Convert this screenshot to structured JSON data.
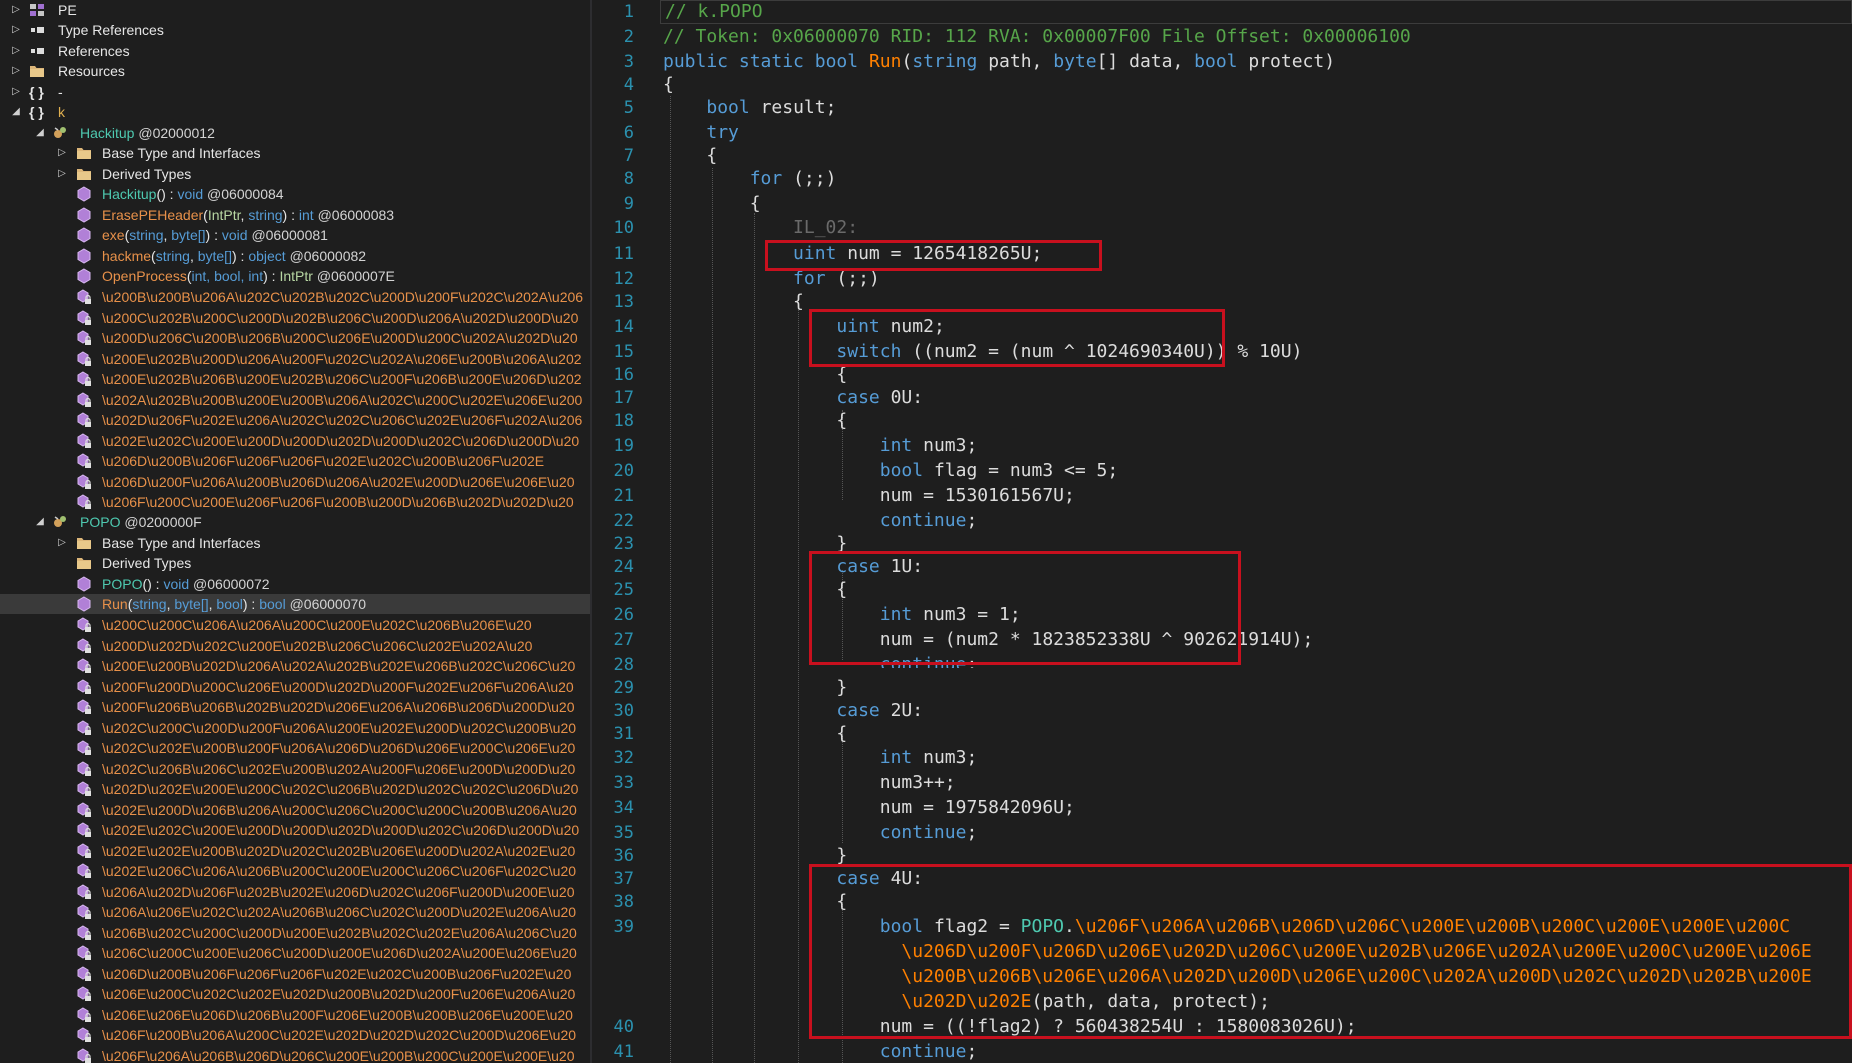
{
  "tree": {
    "top_items": [
      {
        "label": "PE",
        "icon": "pe-module-icon"
      },
      {
        "label": "Type References",
        "icon": "type-references-icon"
      },
      {
        "label": "References",
        "icon": "references-icon"
      },
      {
        "label": "Resources",
        "icon": "folder-icon"
      },
      {
        "label": "-",
        "icon": "namespace-braces-icon"
      },
      {
        "label": "k",
        "icon": "namespace-braces-icon"
      }
    ],
    "hackitup": {
      "name": "Hackitup",
      "token": "@02000012",
      "base_types": "Base Type and Interfaces",
      "derived_types": "Derived Types",
      "methods": [
        {
          "name": "Hackitup",
          "sig": "() : ",
          "ret": "void",
          "tok": "@06000084"
        },
        {
          "name": "ErasePEHeader",
          "p1": "IntPtr",
          "p2": "string",
          "ret": "int",
          "tok": "@06000083"
        },
        {
          "name": "exe",
          "p1": "string",
          "p2": "byte[]",
          "ret": "void",
          "tok": "@06000081"
        },
        {
          "name": "hackme",
          "p1": "string",
          "p2": "byte[]",
          "ret": "object",
          "tok": "@06000082"
        },
        {
          "name": "OpenProcess",
          "p1": "int, bool, int",
          "ret": "IntPtr",
          "tok": "@0600007E"
        }
      ],
      "obf_members": [
        "\\u200B\\u200B\\u206A\\u202C\\u202B\\u202C\\u200D\\u200F\\u202C\\u202A\\u206",
        "\\u200C\\u202B\\u200C\\u200D\\u202B\\u206C\\u200D\\u206A\\u202D\\u200D\\u20",
        "\\u200D\\u206C\\u200B\\u206B\\u200C\\u206E\\u200D\\u200C\\u202A\\u202D\\u20",
        "\\u200E\\u202B\\u200D\\u206A\\u200F\\u202C\\u202A\\u206E\\u200B\\u206A\\u202",
        "\\u200E\\u202B\\u206B\\u200E\\u202B\\u206C\\u200F\\u206B\\u200E\\u206D\\u202",
        "\\u202A\\u202B\\u200B\\u200E\\u200B\\u206A\\u202C\\u200C\\u202E\\u206E\\u200",
        "\\u202D\\u206F\\u202E\\u206A\\u202C\\u202C\\u206C\\u202E\\u206F\\u202A\\u206",
        "\\u202E\\u202C\\u200E\\u200D\\u200D\\u202D\\u200D\\u202C\\u206D\\u200D\\u20",
        "\\u206D\\u200B\\u206F\\u206F\\u206F\\u202E\\u202C\\u200B\\u206F\\u202E",
        "\\u206D\\u200F\\u206A\\u200B\\u206D\\u206A\\u202E\\u200D\\u206E\\u206E\\u20",
        "\\u206F\\u200C\\u200E\\u206F\\u206F\\u200B\\u200D\\u206B\\u202D\\u202D\\u20"
      ]
    },
    "popo": {
      "name": "POPO",
      "token": "@0200000F",
      "base_types": "Base Type and Interfaces",
      "derived_types": "Derived Types",
      "ctor": {
        "name": "POPO",
        "sig": "() : ",
        "ret": "void",
        "tok": "@06000072"
      },
      "run": {
        "name": "Run",
        "p1": "string",
        "p2": "byte[]",
        "p3": "bool",
        "ret": "bool",
        "tok": "@06000070"
      },
      "obf_members": [
        "\\u200C\\u200C\\u206A\\u206A\\u200C\\u200E\\u202C\\u206B\\u206E\\u20",
        "\\u200D\\u202D\\u202C\\u200E\\u202B\\u206C\\u206C\\u202E\\u202A\\u20",
        "\\u200E\\u200B\\u202D\\u206A\\u202A\\u202B\\u202E\\u206B\\u202C\\u206C\\u20",
        "\\u200F\\u200D\\u200C\\u206E\\u200D\\u202D\\u200F\\u202E\\u206F\\u206A\\u20",
        "\\u200F\\u206B\\u206B\\u202B\\u202D\\u206E\\u206A\\u206B\\u206D\\u200D\\u20",
        "\\u202C\\u200C\\u200D\\u200F\\u206A\\u200E\\u202E\\u200D\\u202C\\u200B\\u20",
        "\\u202C\\u202E\\u200B\\u200F\\u206A\\u206D\\u206D\\u206E\\u200C\\u206E\\u20",
        "\\u202C\\u206B\\u206C\\u202E\\u200B\\u202A\\u200F\\u206E\\u200D\\u200D\\u20",
        "\\u202D\\u202E\\u200E\\u200C\\u202C\\u206B\\u202D\\u202C\\u202C\\u206D\\u20",
        "\\u202E\\u200D\\u206B\\u206A\\u200C\\u206C\\u200C\\u200C\\u200B\\u206A\\u20",
        "\\u202E\\u202C\\u200E\\u200D\\u200D\\u202D\\u200D\\u202C\\u206D\\u200D\\u20",
        "\\u202E\\u202E\\u200B\\u202D\\u202C\\u202B\\u206E\\u200D\\u202A\\u202E\\u20",
        "\\u202E\\u206C\\u206A\\u206B\\u200C\\u200E\\u200C\\u206C\\u206F\\u202C\\u20",
        "\\u206A\\u202D\\u206F\\u202B\\u202E\\u206D\\u202C\\u206F\\u200D\\u200E\\u20",
        "\\u206A\\u206E\\u202C\\u202A\\u206B\\u206C\\u202C\\u200D\\u202E\\u206A\\u20",
        "\\u206B\\u202C\\u200C\\u200D\\u200E\\u202B\\u202C\\u202E\\u206A\\u206C\\u20",
        "\\u206C\\u200C\\u200E\\u206C\\u200D\\u200E\\u206D\\u202A\\u200E\\u206E\\u20",
        "\\u206D\\u200B\\u206F\\u206F\\u206F\\u202E\\u202C\\u200B\\u206F\\u202E\\u20",
        "\\u206E\\u200C\\u202C\\u202E\\u202D\\u200B\\u202D\\u200F\\u206E\\u206A\\u20",
        "\\u206E\\u206E\\u206D\\u206B\\u200F\\u206E\\u200B\\u200B\\u206E\\u200E\\u20",
        "\\u206F\\u200B\\u206A\\u200C\\u202E\\u202D\\u202D\\u202C\\u200D\\u206E\\u20",
        "\\u206F\\u206A\\u206B\\u206D\\u206C\\u200E\\u200B\\u200C\\u200E\\u200E\\u20"
      ]
    }
  },
  "code": {
    "line_numbers": [
      "1",
      "2",
      "3",
      "4",
      "5",
      "6",
      "7",
      "8",
      "9",
      "10",
      "11",
      "12",
      "13",
      "14",
      "15",
      "16",
      "17",
      "18",
      "19",
      "20",
      "21",
      "22",
      "23",
      "24",
      "25",
      "26",
      "27",
      "28",
      "29",
      "30",
      "31",
      "32",
      "33",
      "34",
      "35",
      "36",
      "37",
      "38",
      "39",
      "40",
      "41"
    ],
    "l1": "// k.POPO",
    "l2": "// Token: 0x06000070 RID: 112 RVA: 0x00007F00 File Offset: 0x00006100",
    "kw_public": "public",
    "kw_static": "static",
    "kw_bool": "bool",
    "kw_string": "string",
    "kw_byte": "byte",
    "kw_try": "try",
    "kw_for": "for",
    "kw_uint": "uint",
    "kw_int": "int",
    "kw_switch": "switch",
    "kw_case": "case",
    "kw_continue": "continue",
    "method_run": "Run",
    "param_path": "path",
    "param_data": "data",
    "param_protect": "protect",
    "open_brace": "{",
    "close_brace": "}",
    "for_cond": "(;;)",
    "label_il02": "IL_02:",
    "var_result": "result;",
    "var_num": "num",
    "var_num2": "num2",
    "var_num3": "num3",
    "var_flag": "flag",
    "var_flag2": "flag2",
    "n_1265418265": "1265418265U",
    "n_1024690340": "1024690340U",
    "n_10u": "10U",
    "n_0u": "0U",
    "n_1u": "1U",
    "n_2u": "2U",
    "n_4u": "4U",
    "n_5": "5",
    "n_1": "1",
    "n_1530161567": "1530161567U",
    "n_1823852338": "1823852338U",
    "n_902621914": "902621914U",
    "n_1975842096": "1975842096U",
    "n_560438254": "560438254U",
    "n_1580083026": "1580083026U",
    "cls_popo": "POPO",
    "l39_m1": "\\u206F\\u206A\\u206B\\u206D\\u206C\\u200E\\u200B\\u200C\\u200E\\u200E\\u200C",
    "l39_m2": "\\u206D\\u200F\\u206D\\u206E\\u202D\\u206C\\u200E\\u202B\\u206E\\u202A\\u200E\\u200C\\u200E\\u206E",
    "l39_m3": "\\u200B\\u206B\\u206E\\u206A\\u202D\\u200D\\u206E\\u200C\\u202A\\u200D\\u202C\\u202D\\u202B\\u200E",
    "l39_m4": "\\u202D\\u202E"
  }
}
